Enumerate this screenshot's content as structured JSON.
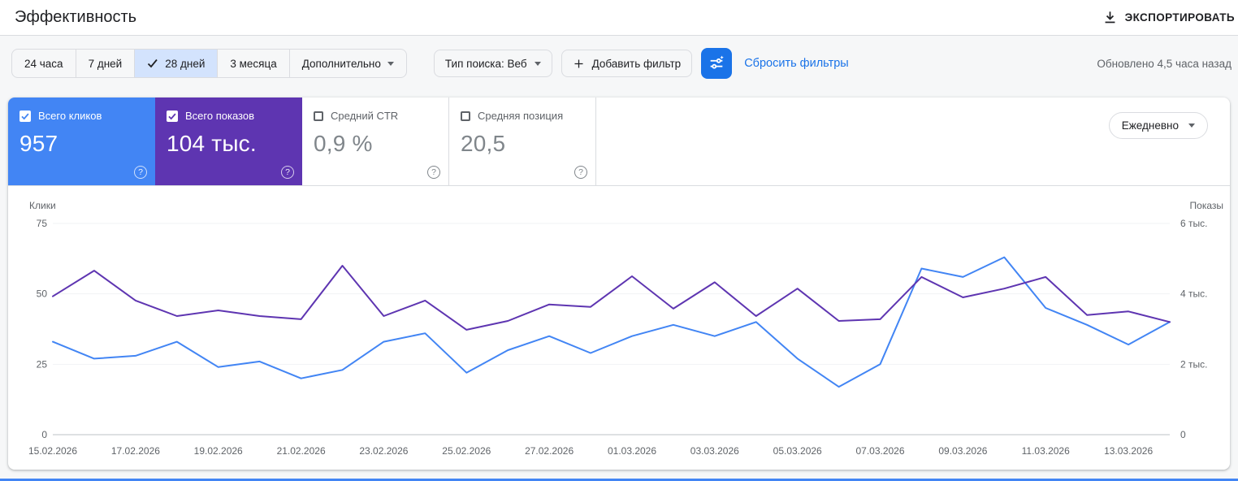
{
  "header": {
    "title": "Эффективность",
    "export_label": "ЭКСПОРТИРОВАТЬ"
  },
  "toolbar": {
    "date_ranges": [
      {
        "label": "24 часа",
        "selected": false
      },
      {
        "label": "7 дней",
        "selected": false
      },
      {
        "label": "28 дней",
        "selected": true
      },
      {
        "label": "3 месяца",
        "selected": false
      }
    ],
    "more_label": "Дополнительно",
    "search_type": "Тип поиска: Веб",
    "add_filter": "Добавить фильтр",
    "reset_filters": "Сбросить фильтры",
    "updated": "Обновлено 4,5 часа назад"
  },
  "metrics": {
    "cards": [
      {
        "label": "Всего кликов",
        "value": "957",
        "checked": true,
        "color": "#4285f4"
      },
      {
        "label": "Всего показов",
        "value": "104 тыс.",
        "checked": true,
        "color": "#5e35b1"
      },
      {
        "label": "Средний CTR",
        "value": "0,9 %",
        "checked": false
      },
      {
        "label": "Средняя позиция",
        "value": "20,5",
        "checked": false
      }
    ],
    "granularity": "Ежедневно"
  },
  "icons": {
    "help": "?"
  },
  "chart_data": {
    "type": "line",
    "title": "",
    "grid": "minimal",
    "legend": "none",
    "x_tick_labels": [
      "15.02.2026",
      "17.02.2026",
      "19.02.2026",
      "21.02.2026",
      "23.02.2026",
      "25.02.2026",
      "27.02.2026",
      "01.03.2026",
      "03.03.2026",
      "05.03.2026",
      "07.03.2026",
      "09.03.2026",
      "11.03.2026",
      "13.03.2026"
    ],
    "left_axis": {
      "label": "Клики",
      "max": 75,
      "ticks": [
        {
          "label": "75",
          "value": 75
        },
        {
          "label": "50",
          "value": 50
        },
        {
          "label": "25",
          "value": 25
        },
        {
          "label": "0",
          "value": 0
        }
      ]
    },
    "right_axis": {
      "label": "Показы",
      "max": 6000,
      "ticks": [
        {
          "label": "6 тыс.",
          "value": 6000
        },
        {
          "label": "4 тыс.",
          "value": 4000
        },
        {
          "label": "2 тыс.",
          "value": 2000
        },
        {
          "label": "0",
          "value": 0
        }
      ]
    },
    "series": [
      {
        "name": "Клики",
        "axis": "left",
        "color": "#4285f4",
        "values": [
          33,
          27,
          28,
          33,
          24,
          26,
          20,
          23,
          33,
          36,
          22,
          30,
          35,
          29,
          35,
          39,
          35,
          40,
          27,
          17,
          25,
          59,
          56,
          63,
          45,
          39,
          32,
          40
        ]
      },
      {
        "name": "Показы",
        "axis": "right",
        "color": "#5e35b1",
        "values": [
          3930,
          4660,
          3810,
          3370,
          3530,
          3370,
          3280,
          4800,
          3370,
          3810,
          2980,
          3230,
          3700,
          3630,
          4500,
          3580,
          4330,
          3370,
          4150,
          3230,
          3280,
          4480,
          3900,
          4150,
          4480,
          3400,
          3500,
          3200
        ]
      }
    ]
  }
}
